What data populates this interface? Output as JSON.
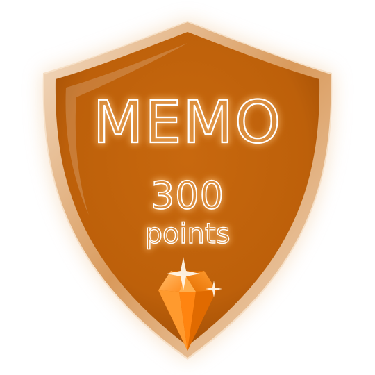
{
  "badge": {
    "title": "MEMO",
    "points_value": "300",
    "points_label": "points"
  },
  "colors": {
    "shield_fill": "#c4650c",
    "shield_dark": "#9a4a06",
    "shield_rim": "#e8cbb0",
    "text_glow": "#ffb35a",
    "gem_light": "#ffb347",
    "gem_mid": "#ff8a1a",
    "gem_dark": "#e06a00",
    "sparkle": "#fff6e8"
  },
  "icons": {
    "badge": "shield-icon",
    "gem": "gem-icon",
    "sparkles": "sparkle-icon"
  }
}
